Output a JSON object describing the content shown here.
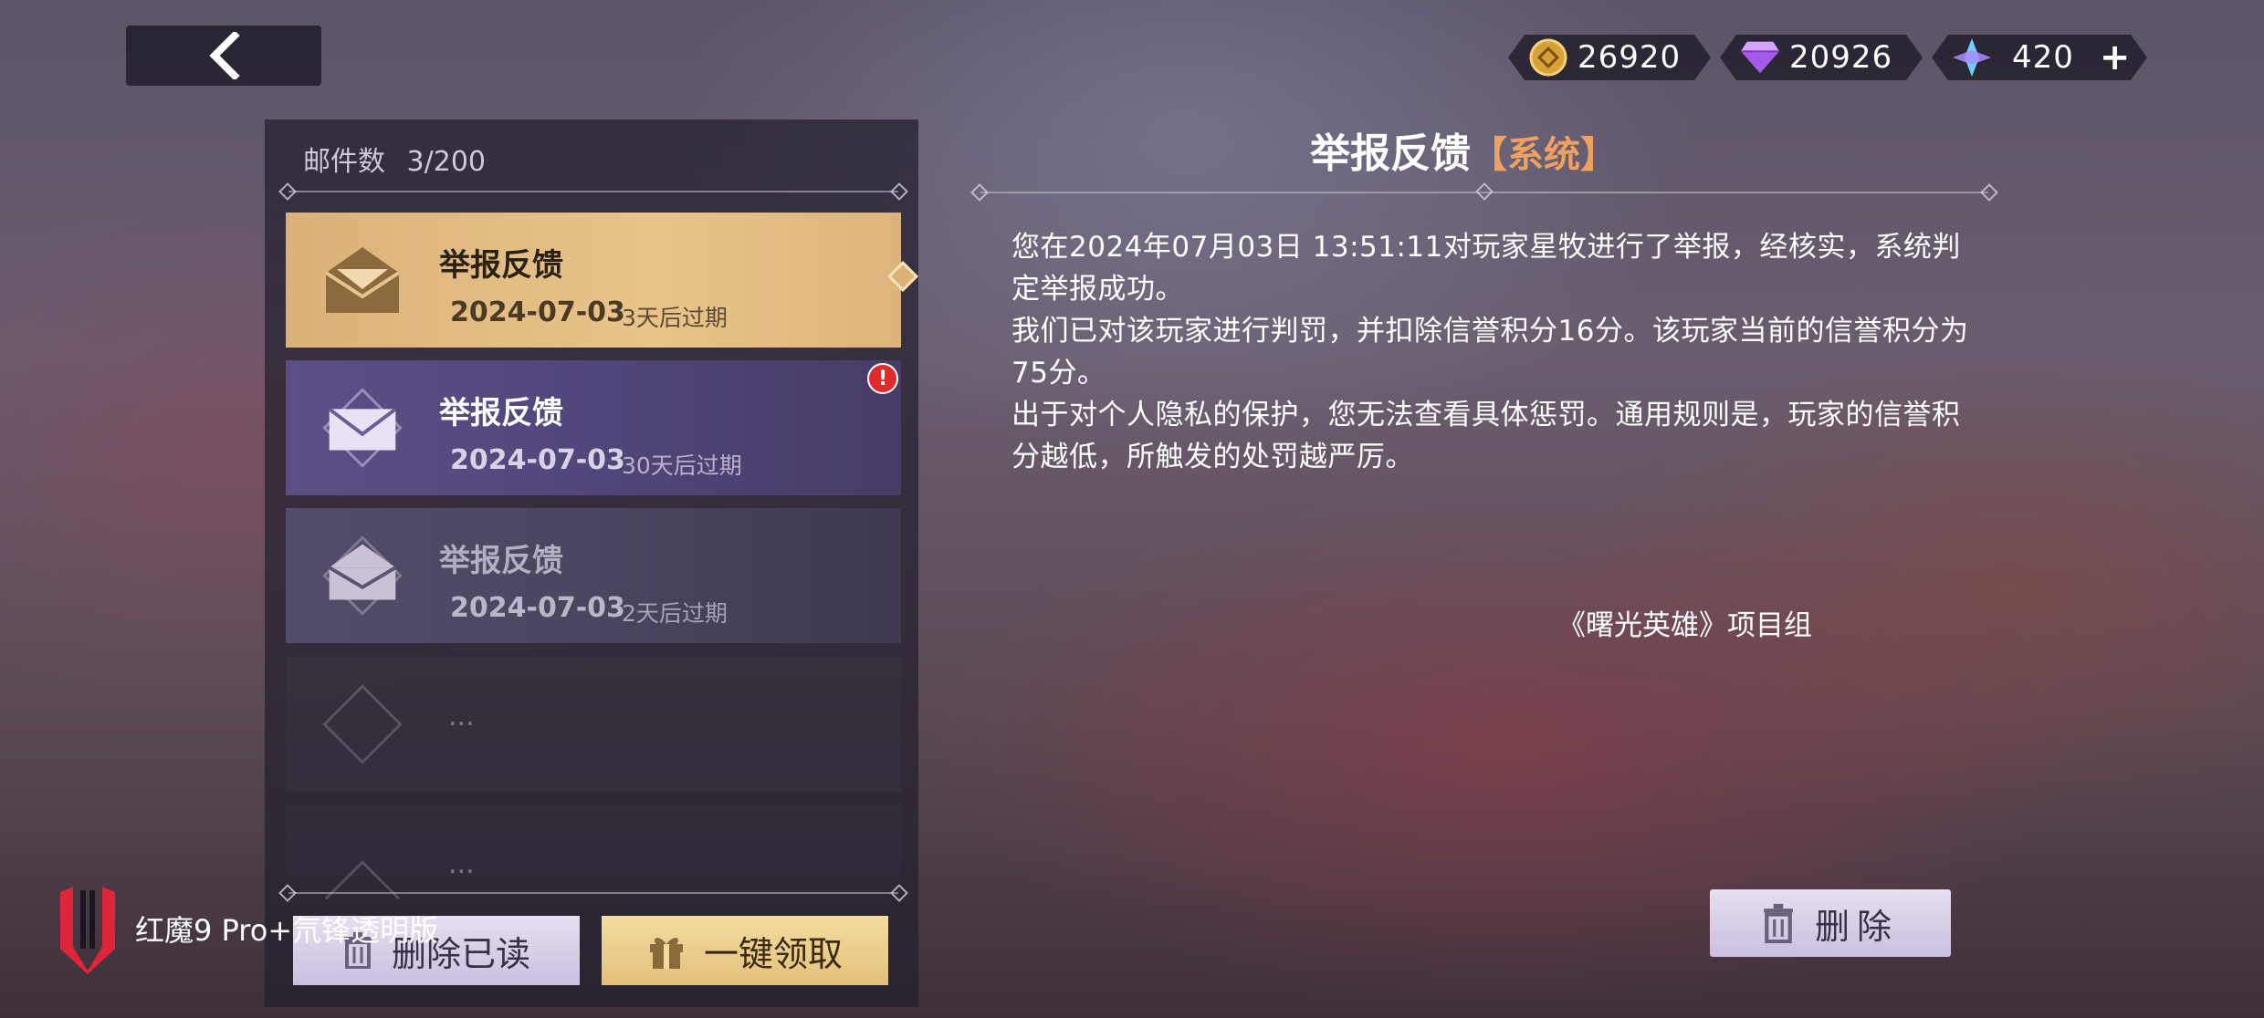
{
  "topbar": {
    "back_icon": "chevron-left-icon",
    "currencies": [
      {
        "icon": "gold-coin-icon",
        "value": "26920"
      },
      {
        "icon": "purple-gem-icon",
        "value": "20926"
      },
      {
        "icon": "blue-crystal-icon",
        "value": "420"
      }
    ],
    "add_label": "+"
  },
  "mail_list": {
    "count_label": "邮件数",
    "count_value": "3/200",
    "items": [
      {
        "title": "举报反馈",
        "date": "2024-07-03",
        "expiry": "3天后过期",
        "state": "selected"
      },
      {
        "title": "举报反馈",
        "date": "2024-07-03",
        "expiry": "30天后过期",
        "state": "unread",
        "alert": "!"
      },
      {
        "title": "举报反馈",
        "date": "2024-07-03",
        "expiry": "2天后过期",
        "state": "read"
      }
    ],
    "placeholder_dots": [
      "...",
      "..."
    ],
    "delete_read_label": "删除已读",
    "claim_all_label": "一键领取"
  },
  "mail_detail": {
    "title": "举报反馈",
    "tag": "【系统】",
    "paragraphs": [
      "您在2024年07月03日 13:51:11对玩家星牧进行了举报，经核实，系统判定举报成功。",
      "我们已对该玩家进行判罚，并扣除信誉积分16分。该玩家当前的信誉积分为75分。",
      "出于对个人隐私的保护，您无法查看具体惩罚。通用规则是，玩家的信誉积分越低，所触发的处罚越严厉。"
    ],
    "signature": "《曙光英雄》项目组",
    "delete_label": "删除"
  },
  "watermark": {
    "text": "红魔9 Pro+氘锋透明版"
  },
  "colors": {
    "selected_item": "#d9b27a",
    "unread_item": "#5d4f86",
    "read_item": "#4a4560",
    "tag": "#f0a060",
    "watermark_logo": "#e0243a"
  }
}
